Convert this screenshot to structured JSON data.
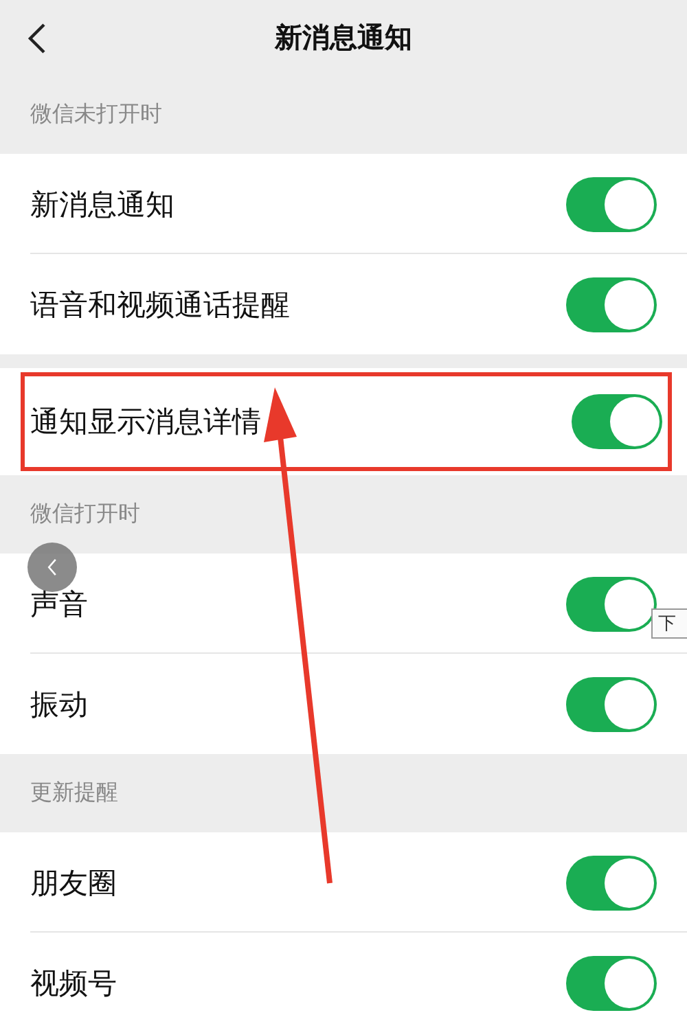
{
  "header": {
    "title": "新消息通知"
  },
  "sections": [
    {
      "label": "微信未打开时",
      "items": [
        {
          "label": "新消息通知",
          "on": true,
          "highlighted": false
        },
        {
          "label": "语音和视频通话提醒",
          "on": true,
          "highlighted": false
        }
      ]
    },
    {
      "items": [
        {
          "label": "通知显示消息详情",
          "on": true,
          "highlighted": true
        }
      ]
    },
    {
      "label": "微信打开时",
      "items": [
        {
          "label": "声音",
          "on": true,
          "highlighted": false
        },
        {
          "label": "振动",
          "on": true,
          "highlighted": false
        }
      ]
    },
    {
      "label": "更新提醒",
      "items": [
        {
          "label": "朋友圈",
          "on": true,
          "highlighted": false
        },
        {
          "label": "视频号",
          "on": true,
          "highlighted": false
        }
      ]
    }
  ],
  "overlay": {
    "tooltip": "下"
  }
}
